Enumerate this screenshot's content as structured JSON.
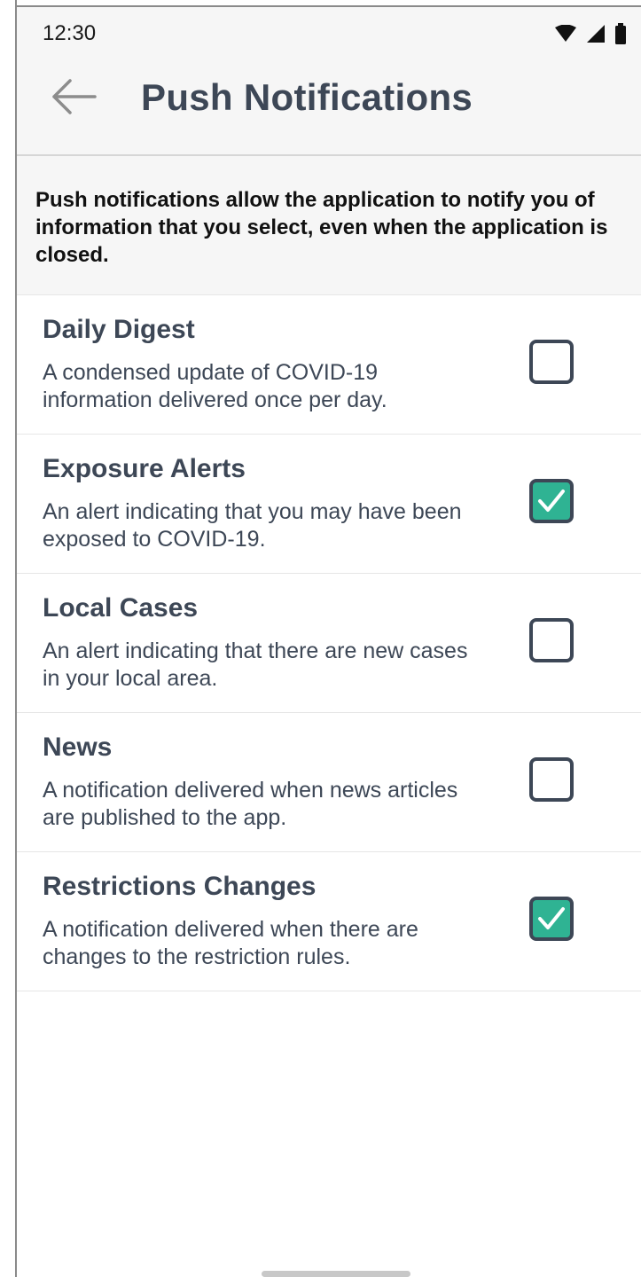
{
  "status_bar": {
    "time": "12:30",
    "icons": [
      "wifi-icon",
      "signal-icon",
      "battery-icon"
    ]
  },
  "header": {
    "back_icon": "back-arrow-icon",
    "title": "Push Notifications"
  },
  "intro": {
    "text": "Push notifications allow the application to notify you of information that you select, even when the application is closed."
  },
  "items": [
    {
      "title": "Daily Digest",
      "description": "A condensed update of COVID-19 information delivered once per day.",
      "checked": false
    },
    {
      "title": "Exposure Alerts",
      "description": "An alert indicating that you may have been exposed to COVID-19.",
      "checked": true
    },
    {
      "title": "Local Cases",
      "description": "An alert indicating that there are new cases in your local area.",
      "checked": false
    },
    {
      "title": "News",
      "description": "A notification delivered when news articles are published to the app.",
      "checked": false
    },
    {
      "title": "Restrictions Changes",
      "description": "A notification delivered when there are changes to the restriction rules.",
      "checked": true
    }
  ],
  "colors": {
    "accent": "#2fb393",
    "text": "#3d4756",
    "header_bg": "#f6f6f6"
  }
}
